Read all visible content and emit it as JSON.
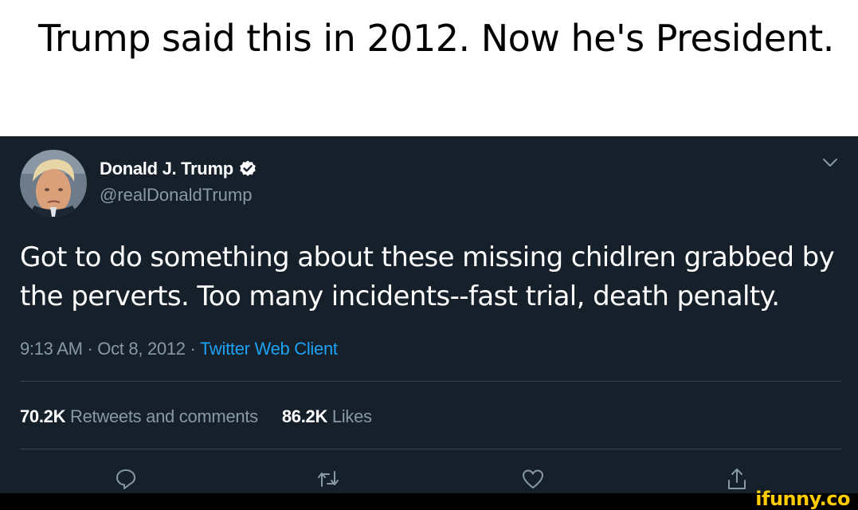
{
  "caption": "Trump said this in 2012. Now he's President.",
  "tweet": {
    "author_name": "Donald J. Trump",
    "handle": "@realDonaldTrump",
    "verified": true,
    "text": "Got to do something about these missing chidlren grabbed by the perverts. Too many incidents--fast trial, death penalty.",
    "time": "9:13 AM",
    "date": "Oct 8, 2012",
    "separator": "·",
    "client": "Twitter Web Client",
    "retweets_count": "70.2K",
    "retweets_label": "Retweets and comments",
    "likes_count": "86.2K",
    "likes_label": "Likes"
  },
  "icons": {
    "avatar": "avatar-photo",
    "verified": "verified-badge-icon",
    "more": "chevron-down-icon",
    "reply": "reply-icon",
    "retweet": "retweet-icon",
    "like": "heart-icon",
    "share": "share-icon"
  },
  "colors": {
    "background": "#15202b",
    "secondary_text": "#8899a6",
    "accent": "#1da1f2",
    "divider": "#38444d",
    "watermark": "#ffcc00"
  },
  "watermark": "ifunny.co"
}
